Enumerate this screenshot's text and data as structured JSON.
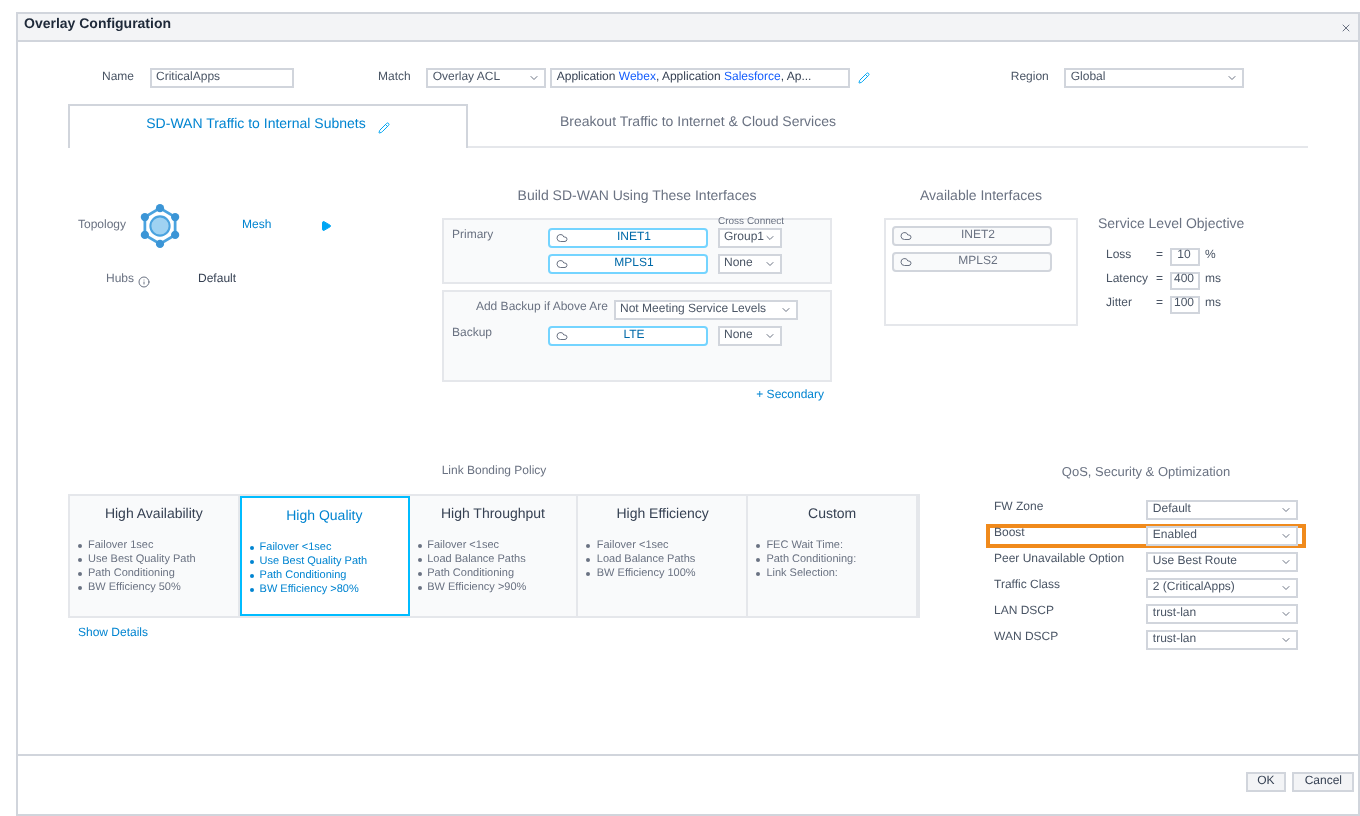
{
  "window": {
    "title": "Overlay Configuration"
  },
  "form": {
    "name_label": "Name",
    "name_value": "CriticalApps",
    "match_label": "Match",
    "match_value": "Overlay ACL",
    "match_text": [
      {
        "kind": "plain",
        "text": "Application "
      },
      {
        "kind": "link",
        "text": "Webex"
      },
      {
        "kind": "plain",
        "text": ", Application "
      },
      {
        "kind": "link",
        "text": "Salesforce"
      },
      {
        "kind": "plain",
        "text": ", Ap..."
      }
    ],
    "region_label": "Region",
    "region_value": "Global"
  },
  "tabs": [
    {
      "label": "SD-WAN Traffic to Internal Subnets",
      "selected": true,
      "edited": true
    },
    {
      "label": "Breakout Traffic to Internet & Cloud Services",
      "selected": false,
      "edited": false
    }
  ],
  "topology": {
    "label": "Topology",
    "value": "Mesh",
    "hubs_label": "Hubs",
    "hubs_value": "Default"
  },
  "build": {
    "title": "Build SD-WAN Using These Interfaces",
    "cross_connect_label": "Cross Connect",
    "primary_label": "Primary",
    "primary": [
      {
        "name": "INET1",
        "cross": "Group1"
      },
      {
        "name": "MPLS1",
        "cross": "None"
      }
    ],
    "backup_condition_label": "Add Backup if Above Are",
    "backup_condition": "Not Meeting Service Levels",
    "backup_label": "Backup",
    "backup": [
      {
        "name": "LTE",
        "cross": "None"
      }
    ],
    "secondary_link": "+ Secondary"
  },
  "available": {
    "title": "Available Interfaces",
    "items": [
      "INET2",
      "MPLS2"
    ]
  },
  "slo": {
    "title": "Service Level Objective",
    "rows": [
      {
        "label": "Loss",
        "operator": "=",
        "value": "10",
        "unit": "%"
      },
      {
        "label": "Latency",
        "operator": "=",
        "value": "400",
        "unit": "ms"
      },
      {
        "label": "Jitter",
        "operator": "=",
        "value": "100",
        "unit": "ms"
      }
    ]
  },
  "bonding": {
    "title": "Link Bonding Policy",
    "options": [
      {
        "title": "High Availability",
        "selected": false,
        "bullets": [
          "Failover 1sec",
          "Use Best Quality Path",
          "Path Conditioning",
          "BW Efficiency 50%"
        ]
      },
      {
        "title": "High Quality",
        "selected": true,
        "bullets": [
          "Failover <1sec",
          "Use Best Quality Path",
          "Path Conditioning",
          "BW Efficiency >80%"
        ]
      },
      {
        "title": "High Throughput",
        "selected": false,
        "bullets": [
          "Failover <1sec",
          "Load Balance Paths",
          "Path Conditioning",
          "BW Efficiency >90%"
        ]
      },
      {
        "title": "High Efficiency",
        "selected": false,
        "bullets": [
          "Failover <1sec",
          "Load Balance Paths",
          "BW Efficiency 100%"
        ]
      },
      {
        "title": "Custom",
        "selected": false,
        "bullets": [
          "FEC Wait Time:",
          "Path Conditioning:",
          "Link Selection:"
        ]
      }
    ],
    "show_details": "Show Details"
  },
  "qos": {
    "title": "QoS, Security & Optimization",
    "rows": [
      {
        "label": "FW Zone",
        "value": "Default",
        "highlighted": false
      },
      {
        "label": "Boost",
        "value": "Enabled",
        "highlighted": true
      },
      {
        "label": "Peer Unavailable Option",
        "value": "Use Best Route",
        "highlighted": false
      },
      {
        "label": "Traffic Class",
        "value": "2 (CriticalApps)",
        "highlighted": false
      },
      {
        "label": "LAN DSCP",
        "value": "trust-lan",
        "highlighted": false
      },
      {
        "label": "WAN DSCP",
        "value": "trust-lan",
        "highlighted": false
      }
    ]
  },
  "buttons": [
    "OK",
    "Cancel"
  ]
}
